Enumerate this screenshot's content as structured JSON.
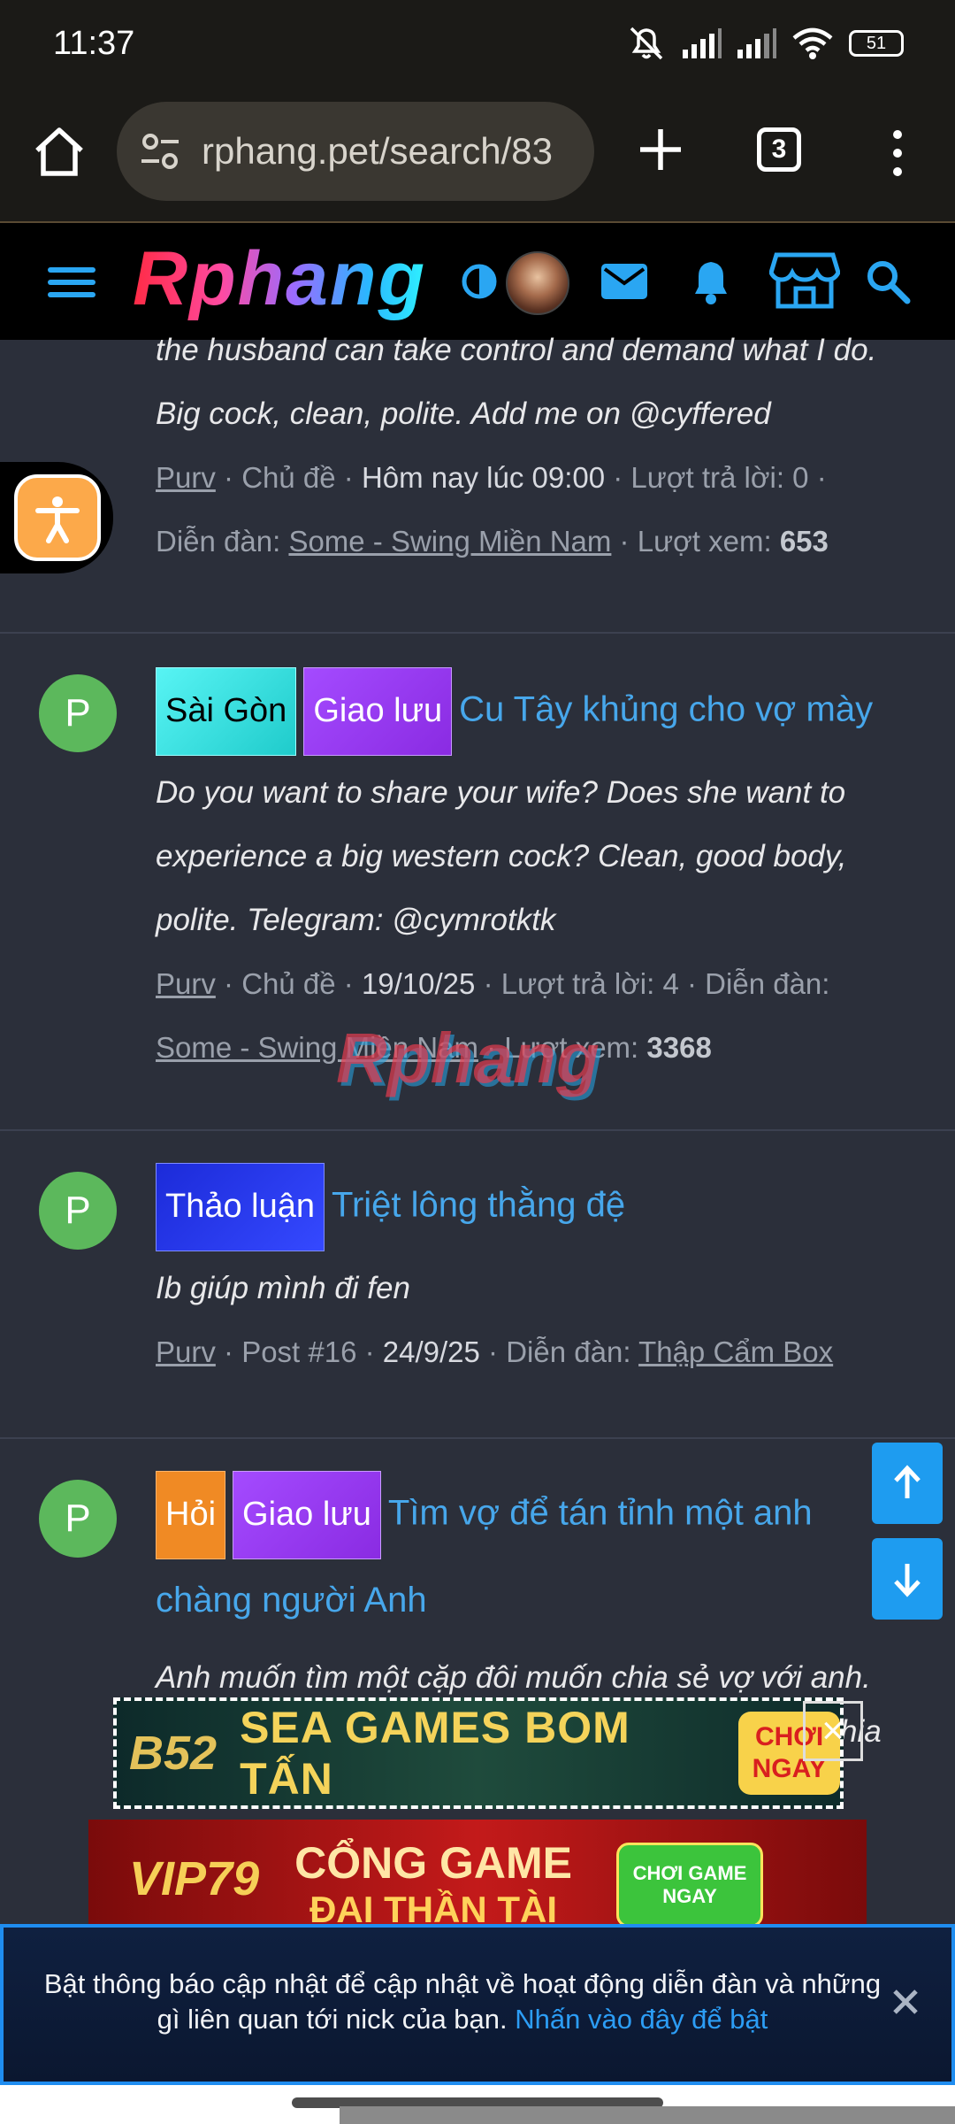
{
  "status_bar": {
    "time": "11:37",
    "battery": "51",
    "icons": [
      "mute-icon",
      "signal-icon",
      "signal-icon",
      "wifi-icon",
      "battery-icon"
    ]
  },
  "browser": {
    "url": "rphang.pet/search/83",
    "tab_count": "3"
  },
  "site": {
    "logo": "Rphang"
  },
  "posts": [
    {
      "snippet_lines": [
        "the husband can take control and demand what I do.",
        "Big cock, clean, polite. Add me on @cyffered"
      ],
      "meta": {
        "user": "Purv",
        "type": "Chủ đề",
        "date": "Hôm nay lúc 09:00",
        "replies_label": "Lượt trả lời:",
        "replies": "0",
        "forum_label": "Diễn đàn:",
        "forum": "Some - Swing Miền Nam",
        "views_label": "Lượt xem:",
        "views": "653"
      }
    },
    {
      "avatar": "P",
      "tags": [
        "Sài Gòn",
        "Giao lưu"
      ],
      "title": "Cu Tây khủng cho vợ mày",
      "snippet_lines": [
        "Do you want to share your wife? Does she want to",
        "experience a big western cock? Clean, good body,",
        "polite. Telegram: @cymrotktk"
      ],
      "meta": {
        "user": "Purv",
        "type": "Chủ đề",
        "date": "19/10/25",
        "replies_label": "Lượt trả lời:",
        "replies": "4",
        "forum_label": "Diễn đàn:",
        "forum": "Some - Swing Miền Nam",
        "views_label": "Lượt xem:",
        "views": "3368"
      }
    },
    {
      "avatar": "P",
      "tags": [
        "Thảo luận"
      ],
      "title": "Triệt lông thằng đệ",
      "snippet_lines": [
        "Ib giúp mình đi fen"
      ],
      "meta": {
        "user": "Purv",
        "type": "Post #16",
        "date": "24/9/25",
        "forum_label": "Diễn đàn:",
        "forum": "Thập Cẩm Box"
      }
    },
    {
      "avatar": "P",
      "tags": [
        "Hỏi",
        "Giao lưu"
      ],
      "title_line1": "Tìm vợ để tán tỉnh một anh",
      "title_line2": "chàng người Anh",
      "snippet_lines": [
        "Anh muốn tìm một cặp đôi muốn chia sẻ vợ với anh."
      ],
      "snippet_tail": "hia"
    }
  ],
  "watermark": "Rphang",
  "ads": {
    "ad1": {
      "brand": "B52",
      "headline": "SEA GAMES BOM TẤN",
      "cta": "CHƠI NGAY"
    },
    "ad2": {
      "brand": "VIP79",
      "headline_l1": "CỔNG GAME",
      "headline_l2": "ĐẠI THẦN TÀI",
      "cta": "CHƠI GAME NGAY"
    }
  },
  "notification": {
    "message": "Bật thông báo cập nhật để cập nhật về hoạt động diễn đàn và những gì liên quan tới nick của bạn.",
    "link": "Nhấn vào đây để bật"
  },
  "colors": {
    "accent": "#47a7eb",
    "background": "#2b2f3a",
    "avatar": "#5cb85c",
    "scroll_button": "#1e9cf0"
  }
}
